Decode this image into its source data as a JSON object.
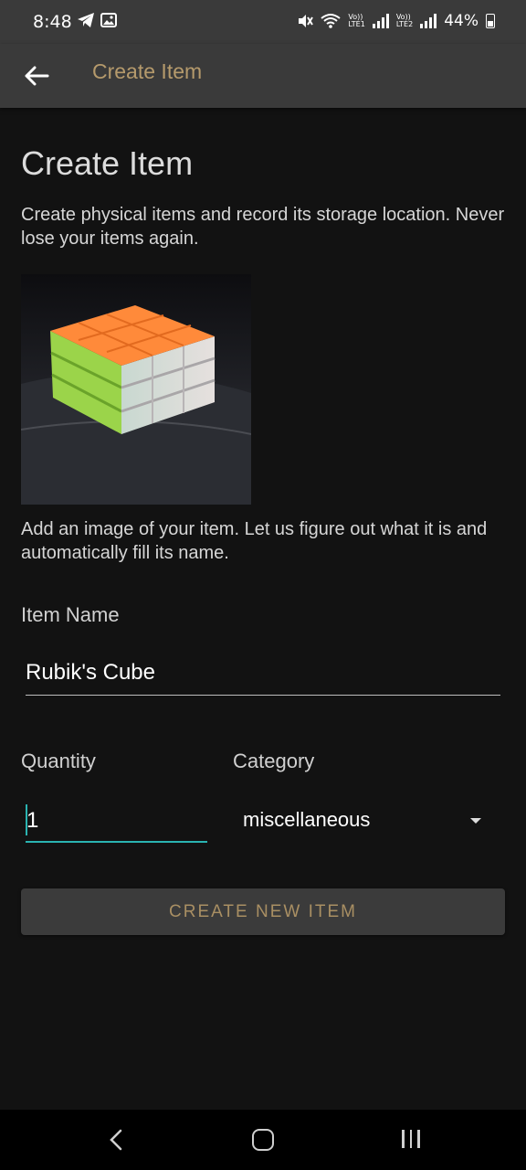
{
  "status_bar": {
    "time": "8:48",
    "battery": "44%",
    "sim1": [
      "Vo))",
      "LTE1"
    ],
    "sim2": [
      "Vo))",
      "LTE2"
    ]
  },
  "app_bar": {
    "title": "Create Item"
  },
  "page": {
    "title": "Create Item",
    "description": "Create physical items and record its storage location. Never lose your items again.",
    "image_hint": "Add an image of your item. Let us figure out what it is and automatically fill its name."
  },
  "form": {
    "name_label": "Item Name",
    "name_value": "Rubik's Cube",
    "quantity_label": "Quantity",
    "quantity_value": "1",
    "category_label": "Category",
    "category_value": "miscellaneous",
    "submit_label": "CREATE NEW ITEM"
  },
  "colors": {
    "accent": "#b59a6c",
    "focus": "#2ab3b1",
    "background": "#121212",
    "app_bar": "#3a3a3a"
  }
}
